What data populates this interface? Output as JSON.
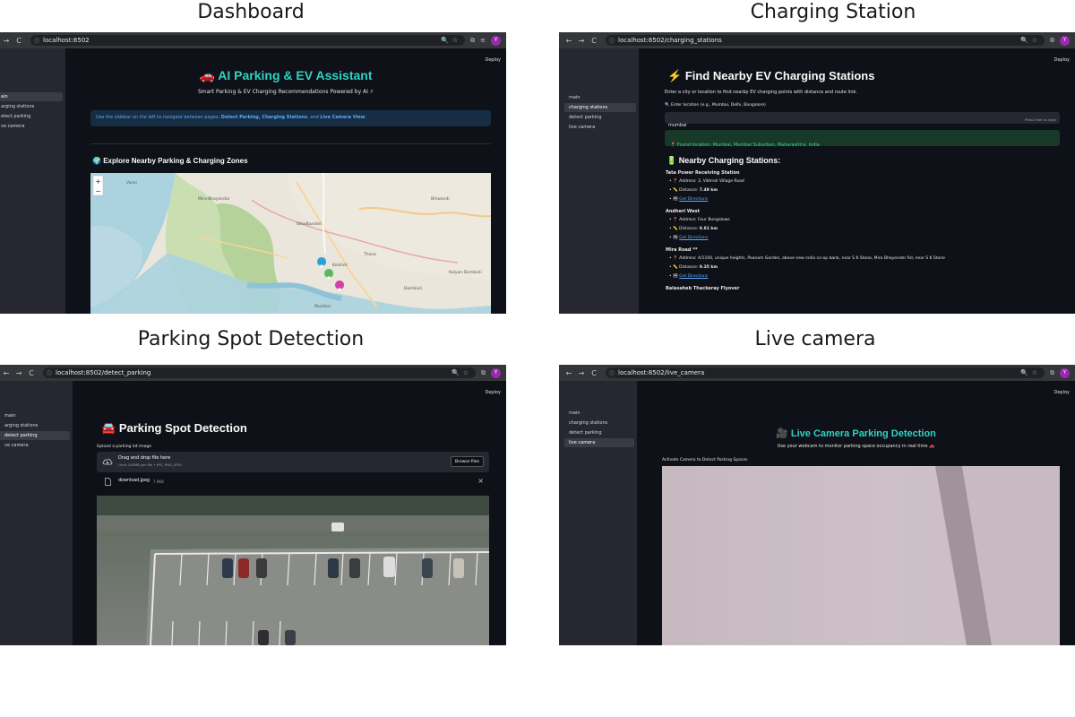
{
  "captions": {
    "dashboard": "Dashboard",
    "charging": "Charging Station",
    "detection": "Parking Spot Detection",
    "live": "Live camera"
  },
  "browser": {
    "back": "←",
    "forward": "→",
    "reload": "C",
    "profile_initial": "Y",
    "deploy": "Deploy",
    "urls": {
      "dashboard": "localhost:8502",
      "charging": "localhost:8502/charging_stations",
      "detection": "localhost:8502/detect_parking",
      "live": "localhost:8502/live_camera"
    }
  },
  "sidebar": {
    "main": "main",
    "charging": "charging stations",
    "detect": "detect parking",
    "live": "live camera",
    "main_cut": "ain",
    "charging_cut": "arging stations",
    "detect_cut": "etect parking",
    "live_cut": "ve camera"
  },
  "dashboard": {
    "title_icon": "🚗",
    "title": "AI Parking & EV Assistant",
    "subtitle": "Smart Parking & EV Charging Recommendations Powered by AI ⚡",
    "info_prefix": "Use the sidebar on the left to navigate between pages: ",
    "info_bold": "Detect Parking, Charging Stations",
    "info_mid": ", and ",
    "info_bold2": "Live Camera View",
    "info_suffix": ".",
    "section_icon": "🌍",
    "section_title": "Explore Nearby Parking & Charging Zones",
    "map_labels": [
      "Mira-Bhayandar",
      "Bhiwandi",
      "Kalyan-Dombivli",
      "Thane",
      "Ghodbunder",
      "Kolshet",
      "Dombivli",
      "Vasai",
      "Mumbai"
    ]
  },
  "charging": {
    "title_icon": "⚡",
    "title": "Find Nearby EV Charging Stations",
    "intro": "Enter a city or location to find nearby EV charging points with distance and route link.",
    "input_label": "🔍 Enter location (e.g., Mumbai, Delhi, Bangalore)",
    "input_value": "mumbai",
    "input_hint": "Press Enter to apply",
    "found": "📍 Found location: Mumbai, Mumbai Suburban, Maharashtra, India",
    "section_icon": "🔋",
    "section_title": "Nearby Charging Stations:",
    "stations": [
      {
        "name": "Tata Power Receiving Station",
        "address_prefix": "📍 Address: ",
        "address": "3, Vikhroli Village Road",
        "distance_prefix": "📏 Distance: ",
        "distance": "7.49 km",
        "link_icon": "🗺",
        "link": "Get Directions"
      },
      {
        "name": "Andheri West",
        "address_prefix": "📍 Address: ",
        "address": "Four Bungalows",
        "distance_prefix": "📏 Distance: ",
        "distance": "8.81 km",
        "link_icon": "🗺",
        "link": "Get Directions"
      },
      {
        "name": "Mira Road **",
        "address_prefix": "📍 Address: ",
        "address": "A/1104, unique heights, Poonam Garden, above new india co-op bank, near S K Stone, Mira Bhayender Rd, near S K Stone",
        "distance_prefix": "📏 Distance: ",
        "distance": "9.35 km",
        "link_icon": "🗺",
        "link": "Get Directions"
      },
      {
        "name": "Balasaheb Thackeray Flyover"
      }
    ]
  },
  "detection": {
    "title_icon": "🚘",
    "title": "Parking Spot Detection",
    "upload_label": "Upload a parking lot image",
    "drop_title": "Drag and drop file here",
    "drop_sub": "Limit 200MB per file • JPG, PNG, JPEG",
    "browse": "Browse files",
    "file_name": "download.jpeg",
    "file_size": "7.9KB",
    "close": "×"
  },
  "live": {
    "title_icon": "🎥",
    "title": "Live Camera Parking Detection",
    "subtitle": "Use your webcam to monitor parking space occupancy in real time 🚗",
    "activate_label": "Activate Camera to Detect Parking Spaces"
  },
  "colors": {
    "accent_teal": "#2fd3c4",
    "info_bg": "#172d43",
    "info_text": "#5aa9ff",
    "success_bg": "#173928",
    "success_text": "#3dd68c",
    "profile": "#9c27b0"
  }
}
